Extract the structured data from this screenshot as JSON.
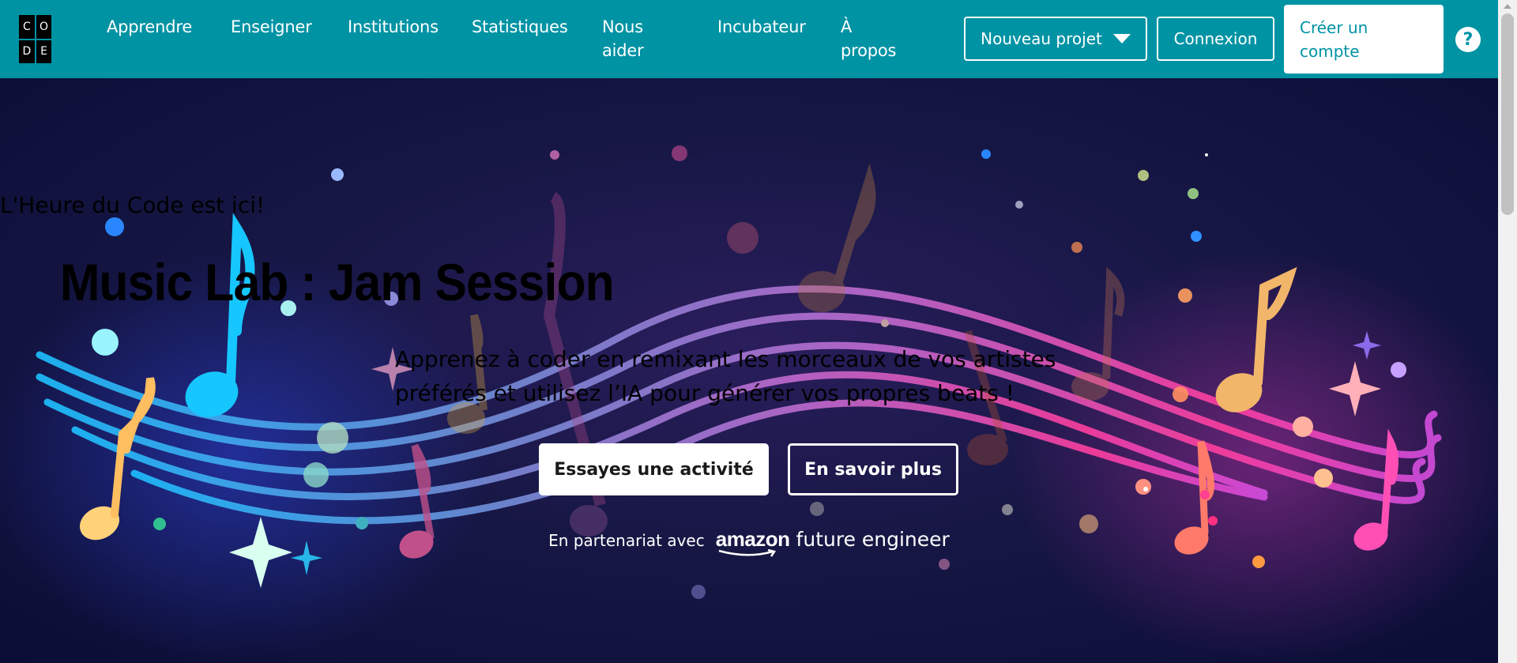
{
  "logo": {
    "letters": [
      "C",
      "O",
      "",
      "D",
      "E"
    ]
  },
  "nav": {
    "items": [
      {
        "label": "Apprendre"
      },
      {
        "label": "Enseigner"
      },
      {
        "label": "Institutions"
      },
      {
        "label": "Statistiques"
      },
      {
        "label": "Nous aider"
      },
      {
        "label": "Incubateur"
      },
      {
        "label": "À propos"
      }
    ],
    "new_project": "Nouveau projet",
    "login": "Connexion",
    "create_account": "Créer un compte",
    "help": "?"
  },
  "hero": {
    "kicker": "L'Heure du Code est ici!",
    "title": "Music Lab : Jam Session",
    "subtitle": "Apprenez à coder en remixant les morceaux de vos artistes préférés et utilisez l’IA pour générer vos propres beats !",
    "primary_button": "Essayes une activité",
    "secondary_button": "En savoir plus",
    "partner_label": "En partenariat avec",
    "partner_brand": "amazon",
    "partner_program": "future engineer"
  },
  "colors": {
    "header_bg": "#0093a4",
    "hero_bg": "#0d0e3a",
    "accent_text": "#0093a4"
  },
  "icons": {
    "dropdown": "caret-down-icon",
    "help": "question-mark-icon"
  }
}
